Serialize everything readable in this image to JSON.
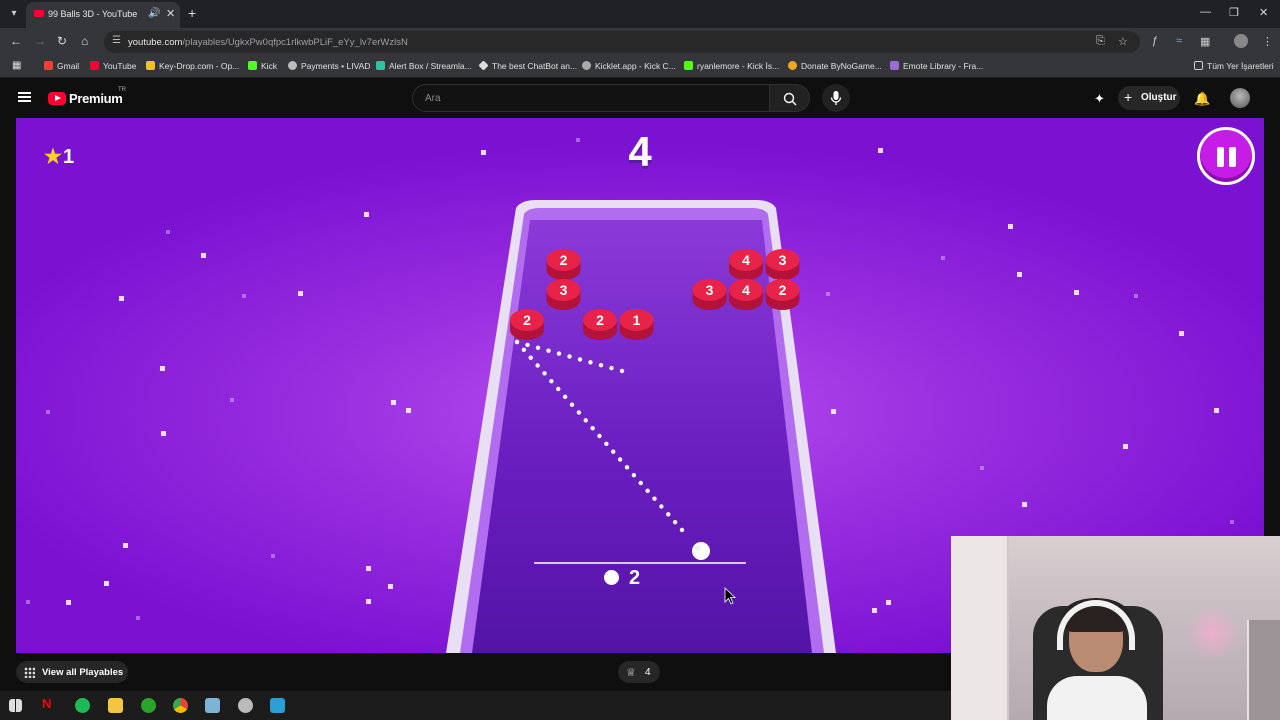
{
  "browser": {
    "tab_title": "99 Balls 3D - YouTube",
    "url_host": "youtube.com",
    "url_path": "/playables/UgkxPw0qfpc1rlkwbPLiF_eYy_lv7erWzlsN",
    "bookmarks": [
      {
        "label": "Gmail",
        "color": "#ea4335"
      },
      {
        "label": "YouTube",
        "color": "#ff0033"
      },
      {
        "label": "Key-Drop.com - Op...",
        "color": "#f0c030"
      },
      {
        "label": "Kick",
        "color": "#53fc18"
      },
      {
        "label": "Payments • LIVAD",
        "color": "#bbbbbb"
      },
      {
        "label": "Alert Box / Streamla...",
        "color": "#31c3a2"
      },
      {
        "label": "The best ChatBot an...",
        "color": "#dddddd"
      },
      {
        "label": "Kicklet.app - Kick C...",
        "color": "#aaaaaa"
      },
      {
        "label": "ryanlemore - Kick İs...",
        "color": "#53fc18"
      },
      {
        "label": "Donate ByNoGame...",
        "color": "#f5a623"
      },
      {
        "label": "Emote Library - Fra...",
        "color": "#9b6bd6"
      }
    ],
    "all_bookmarks": "Tüm Yer İşaretleri"
  },
  "youtube": {
    "logo_text": "Premium",
    "region": "TR",
    "search_placeholder": "Ara",
    "create_label": "Oluştur"
  },
  "game": {
    "title": "99 Balls 3D",
    "stars": "1",
    "level": "4",
    "ball_count": "2",
    "board_balls": [
      {
        "value": "2",
        "col": 1,
        "row": 0
      },
      {
        "value": "4",
        "col": 6,
        "row": 0
      },
      {
        "value": "3",
        "col": 7,
        "row": 0
      },
      {
        "value": "3",
        "col": 1,
        "row": 1
      },
      {
        "value": "3",
        "col": 5,
        "row": 1
      },
      {
        "value": "4",
        "col": 6,
        "row": 1
      },
      {
        "value": "2",
        "col": 7,
        "row": 1
      },
      {
        "value": "2",
        "col": 0,
        "row": 2
      },
      {
        "value": "2",
        "col": 2,
        "row": 2
      },
      {
        "value": "1",
        "col": 3,
        "row": 2
      }
    ],
    "colors": {
      "ball": "#e8234a",
      "bg": "#8a22d8",
      "pause": "#c51ce6",
      "star": "#ffd21f"
    }
  },
  "bottom": {
    "view_all": "View all Playables",
    "crown_count": "4"
  }
}
